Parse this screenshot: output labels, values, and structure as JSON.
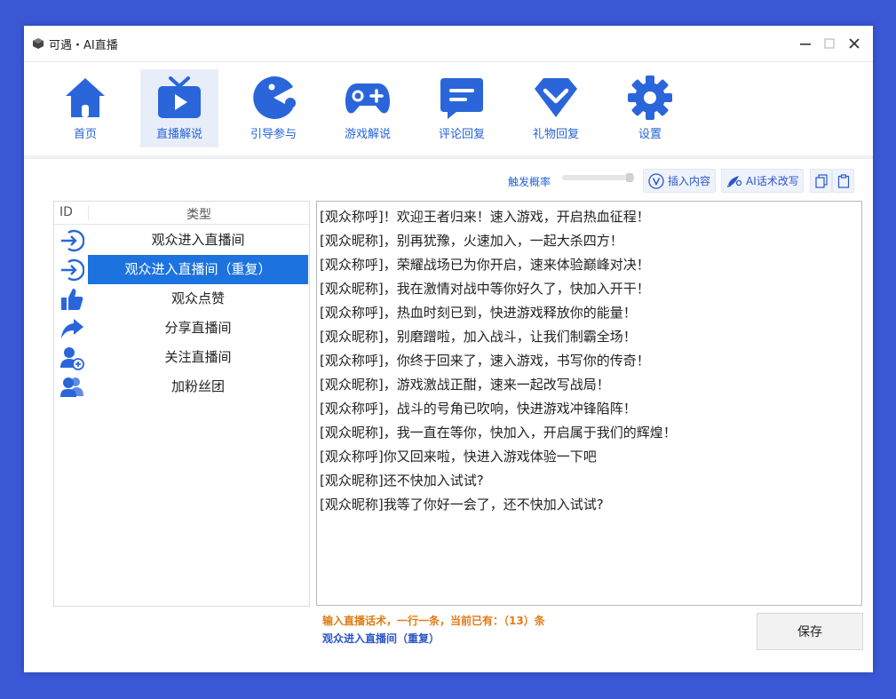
{
  "window": {
    "title": "可遇・AI直播"
  },
  "toolbar": {
    "items": [
      {
        "label": "首页",
        "icon": "home-icon"
      },
      {
        "label": "直播解说",
        "icon": "tv-play-icon"
      },
      {
        "label": "引导参与",
        "icon": "pacman-icon"
      },
      {
        "label": "游戏解说",
        "icon": "gamepad-icon"
      },
      {
        "label": "评论回复",
        "icon": "comment-icon"
      },
      {
        "label": "礼物回复",
        "icon": "gift-chevron-icon"
      },
      {
        "label": "设置",
        "icon": "gear-icon"
      }
    ]
  },
  "options": {
    "rate_label": "触发概率",
    "insert_label": "插入内容",
    "ai_rewrite_label": "AI话术改写"
  },
  "list": {
    "header": {
      "id": "ID",
      "type": "类型"
    },
    "rows": [
      {
        "label": "观众进入直播间",
        "icon": "enter-icon"
      },
      {
        "label": "观众进入直播间（重复）",
        "icon": "enter-icon"
      },
      {
        "label": "观众点赞",
        "icon": "thumbs-up-icon"
      },
      {
        "label": "分享直播间",
        "icon": "share-icon"
      },
      {
        "label": "关注直播间",
        "icon": "add-user-icon"
      },
      {
        "label": "加粉丝团",
        "icon": "users-icon"
      }
    ]
  },
  "editor": {
    "lines": [
      "[观众称呼]！欢迎王者归来！速入游戏，开启热血征程！",
      "[观众昵称]，别再犹豫，火速加入，一起大杀四方！",
      "[观众称呼]，荣耀战场已为你开启，速来体验巅峰对决！",
      "[观众昵称]，我在激情对战中等你好久了，快加入开干！",
      "[观众称呼]，热血时刻已到，快进游戏释放你的能量！",
      "[观众昵称]，别磨蹭啦，加入战斗，让我们制霸全场！",
      "[观众称呼]，你终于回来了，速入游戏，书写你的传奇！",
      "[观众昵称]，游戏激战正酣，速来一起改写战局！",
      "[观众称呼]，战斗的号角已吹响，快进游戏冲锋陷阵！",
      "[观众昵称]，我一直在等你，快加入，开启属于我们的辉煌！",
      "[观众称呼]你又回来啦，快进入游戏体验一下吧",
      "[观众昵称]还不快加入试试?",
      "[观众昵称]我等了你好一会了，还不快加入试试?"
    ]
  },
  "status": {
    "hint": "输入直播话术，一行一条，当前已有：（13）条",
    "selected": "观众进入直播间（重复）"
  },
  "save_label": "保存",
  "colors": {
    "accent": "#2563d8",
    "selected": "#1c73e0",
    "background": "#3a57d6",
    "hint": "#e07b12"
  }
}
